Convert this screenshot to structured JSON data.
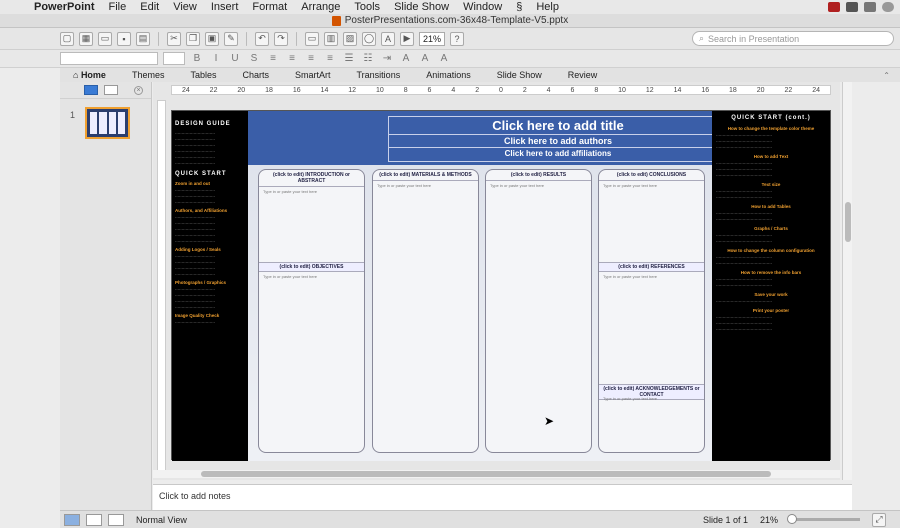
{
  "menubar": {
    "app": "PowerPoint",
    "items": [
      "File",
      "Edit",
      "View",
      "Insert",
      "Format",
      "Arrange",
      "Tools",
      "Slide Show",
      "Window",
      "Help"
    ]
  },
  "window": {
    "title": "PosterPresentations.com-36x48-Template-V5.pptx"
  },
  "toolbar": {
    "zoom": "21%",
    "search_placeholder": "Search in Presentation"
  },
  "ribbon": {
    "tabs": [
      "Home",
      "Themes",
      "Tables",
      "Charts",
      "SmartArt",
      "Transitions",
      "Animations",
      "Slide Show",
      "Review"
    ]
  },
  "sidebar": {
    "slide_number": "1"
  },
  "ruler": {
    "ticks": [
      "24",
      "22",
      "20",
      "18",
      "16",
      "14",
      "12",
      "10",
      "8",
      "6",
      "4",
      "2",
      "0",
      "2",
      "4",
      "6",
      "8",
      "10",
      "12",
      "14",
      "16",
      "18",
      "20",
      "22",
      "24"
    ]
  },
  "poster": {
    "title": "Click here to add title",
    "authors": "Click here to add authors",
    "affiliations": "Click here to add affiliations",
    "columns": [
      {
        "header": "(click to edit) INTRODUCTION or ABSTRACT",
        "placeholder": "Type in or paste your text here",
        "sub_header": "(click to edit) OBJECTIVES",
        "sub_placeholder": "Type in or paste your text here"
      },
      {
        "header": "(click to edit) MATERIALS & METHODS",
        "placeholder": "Type in or paste your text here"
      },
      {
        "header": "(click to edit) RESULTS",
        "placeholder": "Type in or paste your text here"
      },
      {
        "header": "(click to edit) CONCLUSIONS",
        "placeholder": "Type in or paste your text here",
        "sub_header": "(click to edit) REFERENCES",
        "sub_placeholder": "Type in or paste your text here",
        "sub_header2": "(click to edit) ACKNOWLEDGEMENTS or CONTACT",
        "sub_placeholder2": "Type in or paste your text here"
      }
    ],
    "left_panel": {
      "heading": "DESIGN GUIDE",
      "heading2": "QUICK START",
      "orange": [
        "Zoom in and out",
        "Authors, and Affiliations",
        "Adding Logos / Seals",
        "Photographs / Graphics",
        "Image Quality Check"
      ]
    },
    "right_panel": {
      "heading": "QUICK START (cont.)",
      "orange": [
        "How to change the template color theme",
        "How to add Text",
        "Text size",
        "How to add Tables",
        "Graphs / Charts",
        "How to change the column configuration",
        "How to remove the info bars",
        "Save your work",
        "Print your poster"
      ]
    }
  },
  "notes": {
    "placeholder": "Click to add notes"
  },
  "status": {
    "view": "Normal View",
    "slide": "Slide 1 of 1",
    "zoom": "21%"
  }
}
